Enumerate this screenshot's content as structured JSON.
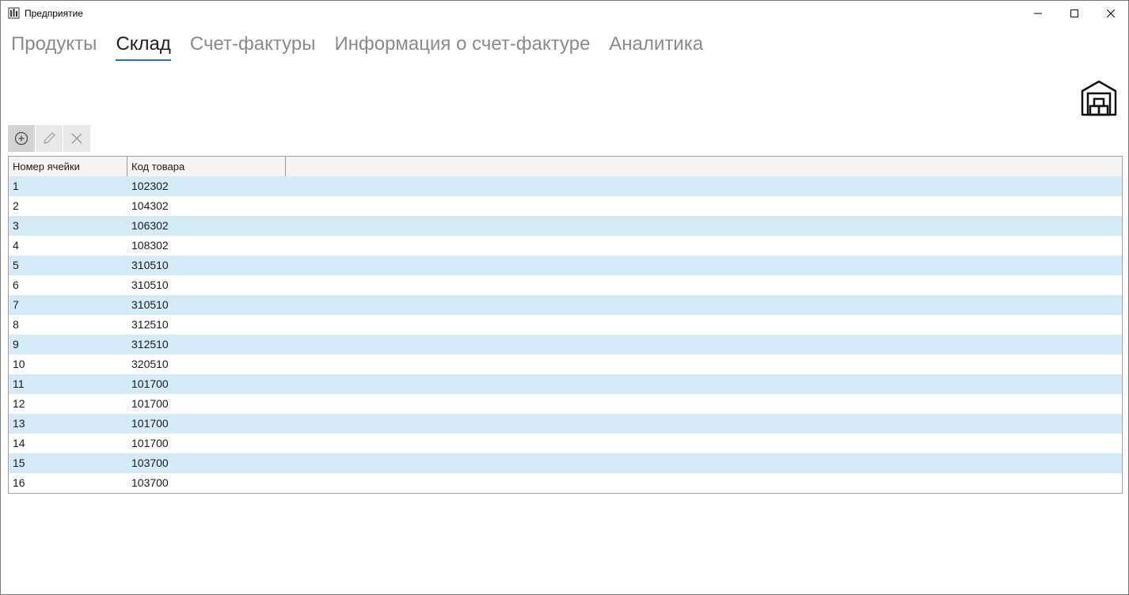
{
  "window": {
    "title": "Предприятие"
  },
  "tabs": [
    {
      "label": "Продукты",
      "active": false
    },
    {
      "label": "Склад",
      "active": true
    },
    {
      "label": "Счет-фактуры",
      "active": false
    },
    {
      "label": "Информация о счет-фактуре",
      "active": false
    },
    {
      "label": "Аналитика",
      "active": false
    }
  ],
  "toolbar": {
    "add_icon": "plus-circle-icon",
    "edit_icon": "pencil-icon",
    "delete_icon": "close-icon"
  },
  "grid": {
    "columns": [
      "Номер ячейки",
      "Код товара"
    ],
    "rows": [
      [
        "1",
        "102302"
      ],
      [
        "2",
        "104302"
      ],
      [
        "3",
        "106302"
      ],
      [
        "4",
        "108302"
      ],
      [
        "5",
        "310510"
      ],
      [
        "6",
        "310510"
      ],
      [
        "7",
        "310510"
      ],
      [
        "8",
        "312510"
      ],
      [
        "9",
        "312510"
      ],
      [
        "10",
        "320510"
      ],
      [
        "11",
        "101700"
      ],
      [
        "12",
        "101700"
      ],
      [
        "13",
        "101700"
      ],
      [
        "14",
        "101700"
      ],
      [
        "15",
        "103700"
      ],
      [
        "16",
        "103700"
      ]
    ]
  },
  "colors": {
    "accent": "#1e73be",
    "row_alt": "#d2ebf7"
  }
}
